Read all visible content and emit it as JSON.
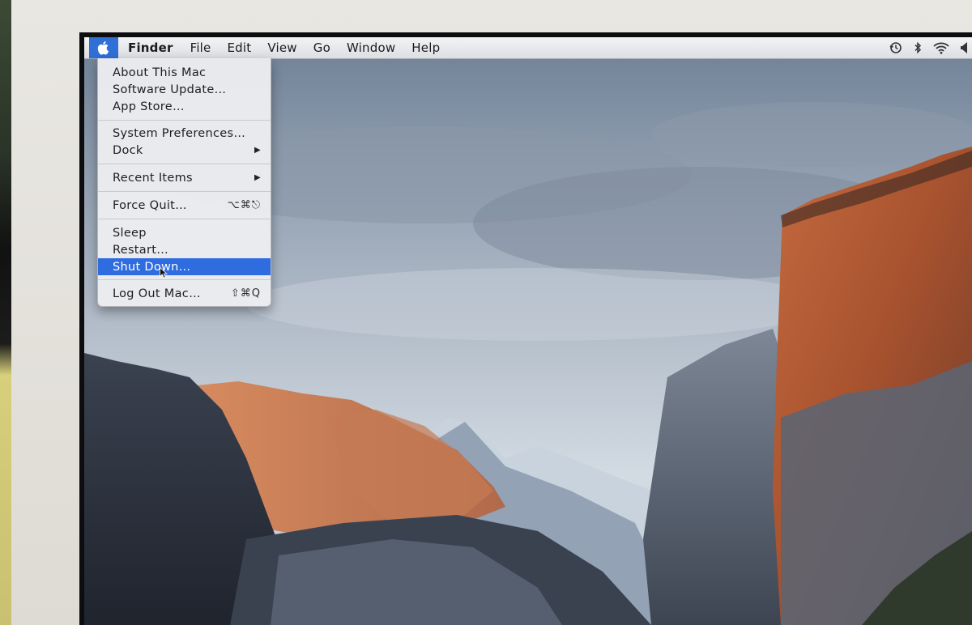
{
  "menubar": {
    "apple_menu": "apple-icon",
    "items": [
      "Finder",
      "File",
      "Edit",
      "View",
      "Go",
      "Window",
      "Help"
    ],
    "status_icons": [
      "time-machine-icon",
      "bluetooth-icon",
      "wifi-icon",
      "volume-icon"
    ]
  },
  "apple_menu": {
    "items": [
      {
        "label": "About This Mac",
        "shortcut": ""
      },
      {
        "label": "Software Update…",
        "shortcut": ""
      },
      {
        "label": "App Store…",
        "shortcut": ""
      },
      {
        "label": "System Preferences…",
        "shortcut": ""
      },
      {
        "label": "Dock",
        "shortcut": "▶"
      },
      {
        "label": "Recent Items",
        "shortcut": "▶"
      },
      {
        "label": "Force Quit…",
        "shortcut": "⌥⌘⎋"
      },
      {
        "label": "Sleep",
        "shortcut": ""
      },
      {
        "label": "Restart…",
        "shortcut": ""
      },
      {
        "label": "Shut Down…",
        "shortcut": ""
      },
      {
        "label": "Log Out Mac…",
        "shortcut": "⇧⌘Q"
      }
    ],
    "selected": "Shut Down…"
  },
  "colors": {
    "selection": "#2f6ce0",
    "menubar": "#e6e8eb"
  }
}
